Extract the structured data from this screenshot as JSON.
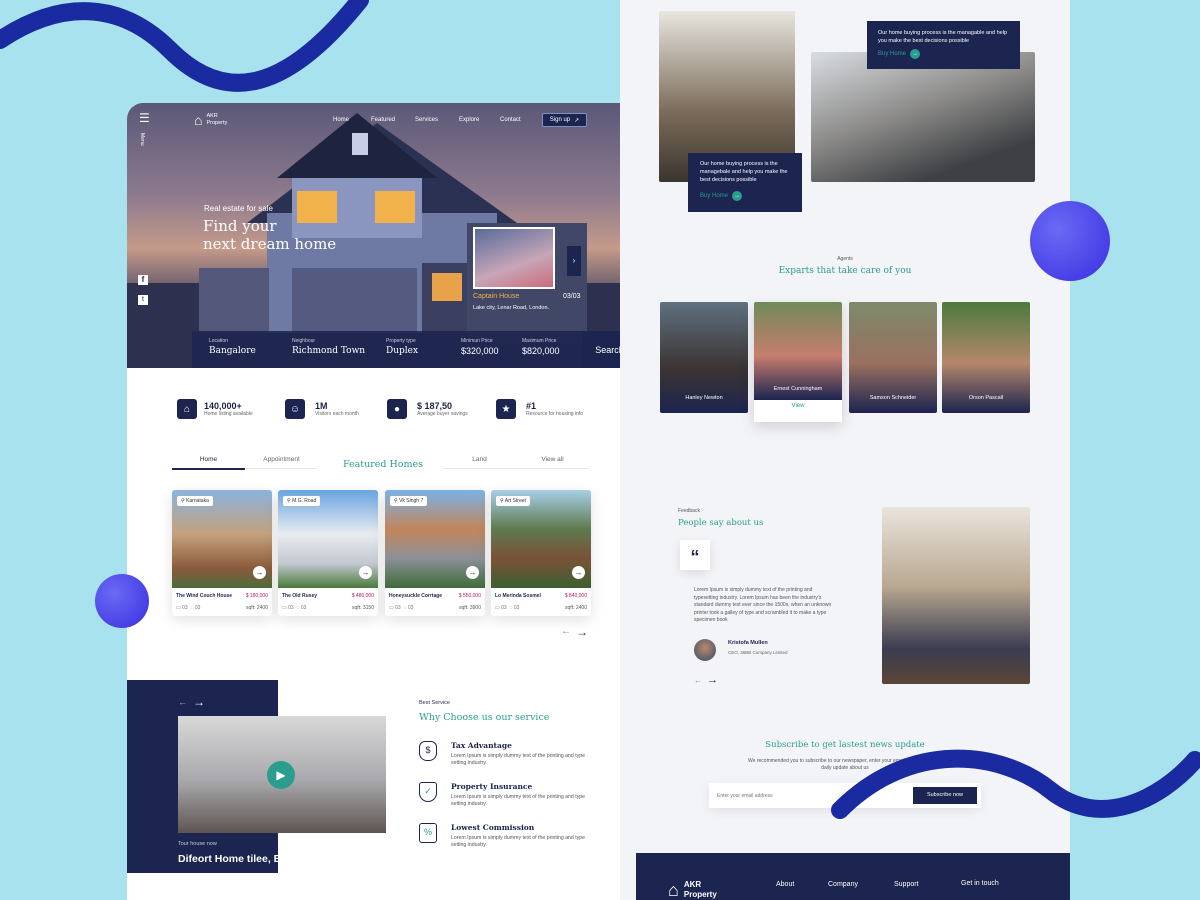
{
  "brand": {
    "name": "AKR",
    "sub": "Property"
  },
  "menu_label": "Menu",
  "nav": [
    "Home",
    "Featured",
    "Services",
    "Explore",
    "Contact"
  ],
  "signup": "Sign up",
  "hero": {
    "kicker": "Real estate for sale",
    "title_line1": "Find your",
    "title_line2": "next dream home",
    "preview_name": "Captain House",
    "preview_count": "03/03",
    "preview_addr": "Lake city, Lenar Road, London."
  },
  "search": {
    "fields": [
      {
        "label": "Location",
        "value": "Bangalore"
      },
      {
        "label": "Neighbour",
        "value": "Richmond Town"
      },
      {
        "label": "Property type",
        "value": "Duplex"
      },
      {
        "label": "Minimun Price",
        "value": "$320,000"
      },
      {
        "label": "Maximum Price",
        "value": "$820,000"
      }
    ],
    "button": "Search"
  },
  "stats": [
    {
      "value": "140,000+",
      "label": "Home listing available"
    },
    {
      "value": "1M",
      "label": "Visitors each month"
    },
    {
      "value": "$ 187,50",
      "label": "Average buyer savings"
    },
    {
      "value": "#1",
      "label": "Resource for housing info"
    }
  ],
  "tabs": [
    "Home",
    "Appointment",
    "Featured Homes",
    "Land",
    "View all"
  ],
  "listings": [
    {
      "chip": "Karnataka",
      "name": "The Wind Couch House",
      "price": "$ 180,000",
      "beds": "03",
      "baths": "03",
      "sqft": "sqft: 2400"
    },
    {
      "chip": "M.G. Road",
      "name": "The Old Rusey",
      "price": "$ 480,000",
      "beds": "03",
      "baths": "03",
      "sqft": "sqft: 3150"
    },
    {
      "chip": "Vk Singh 7",
      "name": "Honeysuckle Corrtage",
      "price": "$ 550,000",
      "beds": "03",
      "baths": "03",
      "sqft": "sqft: 3900"
    },
    {
      "chip": "Art Street",
      "name": "Lo Merinda Sosmel",
      "price": "$ 840,000",
      "beds": "03",
      "baths": "03",
      "sqft": "sqft: 2400"
    }
  ],
  "tour": {
    "kicker": "Tour house now",
    "title": "Difeort Home tilee, Bangalore"
  },
  "service": {
    "kicker": "Best Service",
    "title": "Why Choose us our service",
    "items": [
      {
        "title": "Tax Advantage",
        "text": "Lorem Ipsum is simply dummy text of the printing and type setting industry."
      },
      {
        "title": "Property Insurance",
        "text": "Lorem Ipsum is simply dummy text of the printing and type setting industry."
      },
      {
        "title": "Lowest Commission",
        "text": "Lorem Ipsum is simply dummy text of the printing and type setting industry."
      }
    ]
  },
  "promo": {
    "text": "Our home buying process is the managable and help you make the best decisions possible",
    "cta": "Buy Home"
  },
  "promo2": {
    "text": "Our home buying process is the managebale and help you make the best decisions possible",
    "cta": "Buy Home"
  },
  "agents": {
    "kicker": "Agents",
    "title": "Exparts that take care of you",
    "people": [
      "Hanley Newton",
      "Ernest Cunningham",
      "Samson Schneider",
      "Orson Pascall"
    ],
    "view": "View"
  },
  "feedback": {
    "kicker": "Feedback",
    "title": "People say about us",
    "quote": "Lorem Ipsum is simply dummy text of the printing and typesetting industry. Lorem Ipsum has been the industry's standard dummy text ever since the 1500s, when an unknown printer took a galley of type and scrambled it to make a type specimen book",
    "author": "Kristofa Mullen",
    "role": "CEO, 36BB Company Limited"
  },
  "subscribe": {
    "title": "Subscribe to get lastest news update",
    "text": "We recommended you to subscribe to our newspaper, enter your email below to get our daily update about us",
    "placeholder": "Enter your email address",
    "button": "Subscribe now"
  },
  "footer": {
    "brand": "AKR",
    "brand_sub": "Property",
    "links": [
      "About",
      "Company",
      "Support",
      "Get in touch"
    ]
  },
  "colors": {
    "navy": "#1c2450",
    "teal": "#2a9d8f",
    "accent": "#c2185b",
    "bg": "#a8e2ef",
    "wave": "#1a2aa0",
    "ball": "#4a3ee0"
  }
}
